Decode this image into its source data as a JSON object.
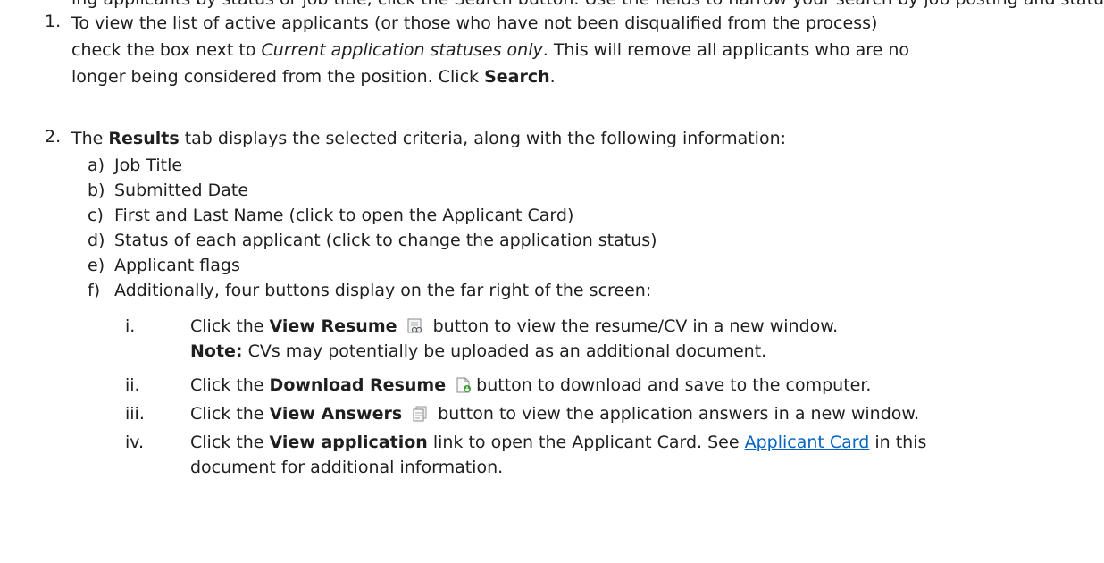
{
  "doc": {
    "top_fragment": "ing applicants by status or job title, click the Search button. Use the fields to narrow your search by job posting and status.",
    "step1": {
      "number": "1.",
      "line1": "To view the list of active applicants (or those who have not been disqualified from the process)",
      "line2_a": "check the box next to ",
      "line2_em": "Current application statuses only",
      "line2_b": ". This will remove all applicants who are no",
      "line3_a": "longer being considered from the position. Click ",
      "line3_strong": "Search",
      "line3_b": "."
    },
    "step2": {
      "number": "2.",
      "text_a": "The ",
      "text_strong": "Results",
      "text_b": " tab displays the selected criteria, along with the following information:",
      "items": [
        {
          "marker": "a)",
          "text": "Job Title"
        },
        {
          "marker": "b)",
          "text": "Submitted Date"
        },
        {
          "marker": "c)",
          "text": "First and Last Name (click to open the Applicant Card)"
        },
        {
          "marker": "d)",
          "text": "Status of each applicant (click to change the application status)"
        },
        {
          "marker": "e)",
          "text": "Applicant flags"
        },
        {
          "marker": "f)",
          "text": "Additionally, four buttons display on the far right of the screen:"
        }
      ],
      "subitems": {
        "i": {
          "marker": "i.",
          "a": "Click the ",
          "strong": "View Resume",
          "b": " button to view the resume/CV in a new window.",
          "note_label": "Note:",
          "note_text": " CVs may potentially be uploaded as an additional document.",
          "icon": "view-resume-icon"
        },
        "ii": {
          "marker": "ii.",
          "a": "Click the ",
          "strong": "Download Resume",
          "b": "button to download and save to the computer.",
          "icon": "download-resume-icon"
        },
        "iii": {
          "marker": "iii.",
          "a": "Click the ",
          "strong": "View Answers",
          "b": " button to view the application answers in a new window.",
          "icon": "view-answers-icon"
        },
        "iv": {
          "marker": "iv.",
          "a": "Click the ",
          "strong": "View application",
          "b": " link to open the Applicant Card. See ",
          "link": "Applicant Card",
          "c": " in this",
          "line2": "document for additional information."
        }
      }
    }
  }
}
